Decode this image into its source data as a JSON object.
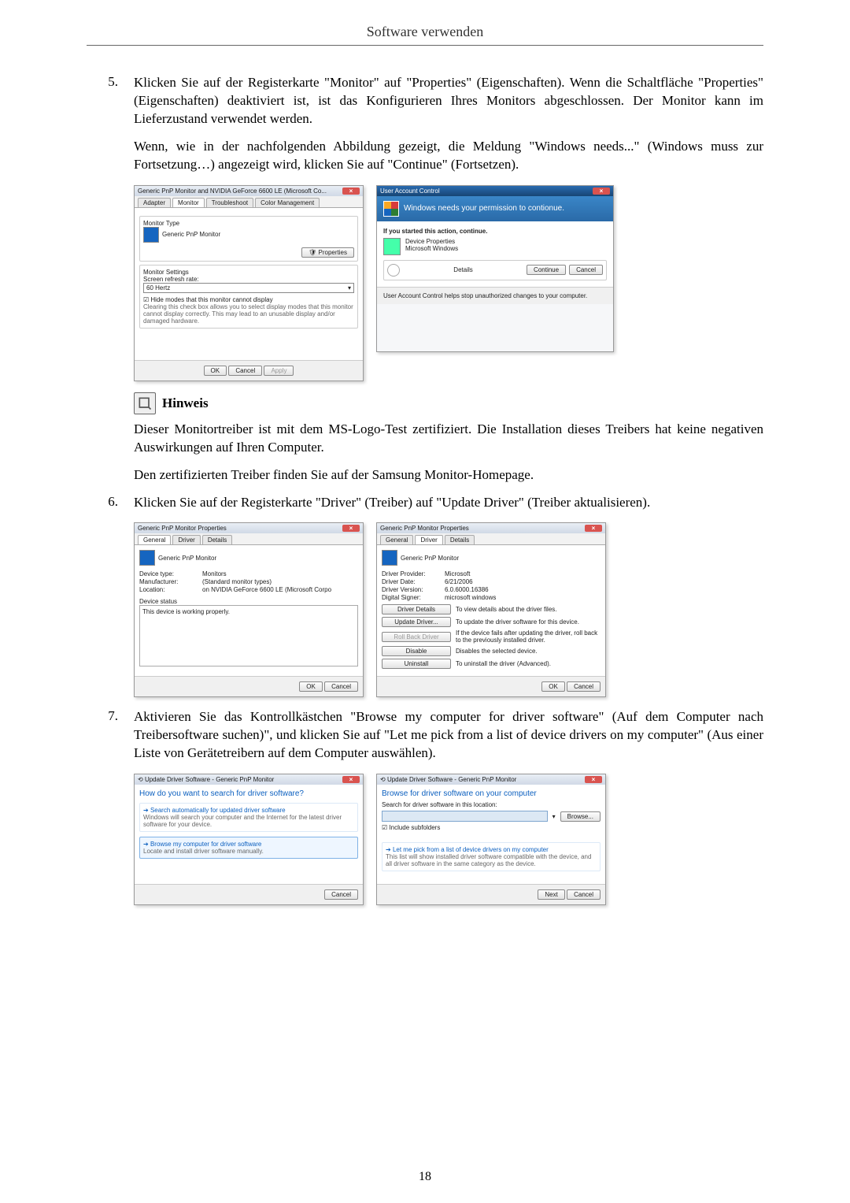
{
  "header_title": "Software verwenden",
  "steps": {
    "s5": {
      "num": "5.",
      "p1": "Klicken Sie auf der Registerkarte \"Monitor\" auf \"Properties\" (Eigenschaften). Wenn die Schaltfläche \"Properties\" (Eigenschaften) deaktiviert ist, ist das Konfigurieren Ihres Monitors abgeschlossen. Der Monitor kann im Lieferzustand verwendet werden.",
      "p2": "Wenn, wie in der nachfolgenden Abbildung gezeigt, die Meldung \"Windows needs...\" (Windows muss zur Fortsetzung…) angezeigt wird, klicken Sie auf \"Continue\" (Fortsetzen)."
    },
    "s6": {
      "num": "6.",
      "p1": "Klicken Sie auf der Registerkarte \"Driver\" (Treiber) auf \"Update Driver\" (Treiber aktualisieren)."
    },
    "s7": {
      "num": "7.",
      "p1": "Aktivieren Sie das Kontrollkästchen \"Browse my computer for driver software\" (Auf dem Computer nach Treibersoftware suchen)\", und klicken Sie auf \"Let me pick from a list of device drivers on my computer\" (Aus einer Liste von Gerätetreibern auf dem Computer auswählen)."
    }
  },
  "note": {
    "label": "Hinweis",
    "p1": "Dieser Monitortreiber ist mit dem MS-Logo-Test zertifiziert. Die Installation dieses Treibers hat keine negativen Auswirkungen auf Ihren Computer.",
    "p2": "Den zertifizierten Treiber finden Sie auf der Samsung Monitor-Homepage."
  },
  "page_number": "18",
  "win_monitor": {
    "title": "Generic PnP Monitor and NVIDIA GeForce 6600 LE (Microsoft Co...",
    "tabs": {
      "adapter": "Adapter",
      "monitor": "Monitor",
      "troubleshoot": "Troubleshoot",
      "color": "Color Management"
    },
    "type_label": "Monitor Type",
    "type_value": "Generic PnP Monitor",
    "properties_btn": "Properties",
    "settings_label": "Monitor Settings",
    "refresh_label": "Screen refresh rate:",
    "refresh_value": "60 Hertz",
    "hide_modes": "Hide modes that this monitor cannot display",
    "hide_desc": "Clearing this check box allows you to select display modes that this monitor cannot display correctly. This may lead to an unusable display and/or damaged hardware.",
    "ok": "OK",
    "cancel": "Cancel",
    "apply": "Apply"
  },
  "win_uac": {
    "title": "User Account Control",
    "banner": "Windows needs your permission to contionue.",
    "if_started": "If you started this action, continue.",
    "item_name": "Device Properties",
    "item_pub": "Microsoft Windows",
    "details": "Details",
    "continue": "Continue",
    "cancel": "Cancel",
    "footer": "User Account Control helps stop unauthorized changes to your computer."
  },
  "win_props_general": {
    "title": "Generic PnP Monitor Properties",
    "tabs": {
      "general": "General",
      "driver": "Driver",
      "details": "Details"
    },
    "name": "Generic PnP Monitor",
    "k_devtype": "Device type:",
    "v_devtype": "Monitors",
    "k_mfr": "Manufacturer:",
    "v_mfr": "(Standard monitor types)",
    "k_loc": "Location:",
    "v_loc": "on NVIDIA GeForce 6600 LE (Microsoft Corpo",
    "status_label": "Device status",
    "status_text": "This device is working properly.",
    "ok": "OK",
    "cancel": "Cancel"
  },
  "win_props_driver": {
    "title": "Generic PnP Monitor Properties",
    "tabs": {
      "general": "General",
      "driver": "Driver",
      "details": "Details"
    },
    "name": "Generic PnP Monitor",
    "k_provider": "Driver Provider:",
    "v_provider": "Microsoft",
    "k_date": "Driver Date:",
    "v_date": "6/21/2006",
    "k_version": "Driver Version:",
    "v_version": "6.0.6000.16386",
    "k_signer": "Digital Signer:",
    "v_signer": "microsoft windows",
    "btn_details": "Driver Details",
    "desc_details": "To view details about the driver files.",
    "btn_update": "Update Driver...",
    "desc_update": "To update the driver software for this device.",
    "btn_rollback": "Roll Back Driver",
    "desc_rollback": "If the device fails after updating the driver, roll back to the previously installed driver.",
    "btn_disable": "Disable",
    "desc_disable": "Disables the selected device.",
    "btn_uninstall": "Uninstall",
    "desc_uninstall": "To uninstall the driver (Advanced).",
    "ok": "OK",
    "cancel": "Cancel"
  },
  "win_search": {
    "title": "Update Driver Software - Generic PnP Monitor",
    "heading": "How do you want to search for driver software?",
    "opt1_title": "Search automatically for updated driver software",
    "opt1_desc": "Windows will search your computer and the Internet for the latest driver software for your device.",
    "opt2_title": "Browse my computer for driver software",
    "opt2_desc": "Locate and install driver software manually.",
    "cancel": "Cancel"
  },
  "win_browse": {
    "title": "Update Driver Software - Generic PnP Monitor",
    "heading": "Browse for driver software on your computer",
    "loc_label": "Search for driver software in this location:",
    "browse": "Browse...",
    "include_sub": "Include subfolders",
    "pick_title": "Let me pick from a list of device drivers on my computer",
    "pick_desc": "This list will show installed driver software compatible with the device, and all driver software in the same category as the device.",
    "next": "Next",
    "cancel": "Cancel"
  }
}
